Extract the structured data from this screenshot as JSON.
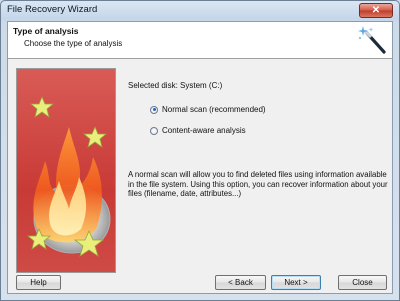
{
  "window": {
    "title": "File Recovery Wizard",
    "close_glyph": "✕"
  },
  "header": {
    "title": "Type of analysis",
    "subtitle": "Choose the type of analysis",
    "icon": "magic-wand-icon"
  },
  "main": {
    "selected_disk": "Selected disk: System (C:)",
    "options": [
      {
        "label": "Normal scan (recommended)",
        "selected": true
      },
      {
        "label": "Content-aware analysis",
        "selected": false
      }
    ],
    "description": "A normal scan will allow you to find deleted files using information available in the file system. Using this option, you can recover information about your files (filename, date, attributes...)"
  },
  "buttons": {
    "help": "Help",
    "back": "< Back",
    "next": "Next >",
    "close": "Close"
  },
  "colors": {
    "accent": "#2b62b8",
    "art_bg": "#c83a36",
    "close_red": "#c0392b"
  }
}
